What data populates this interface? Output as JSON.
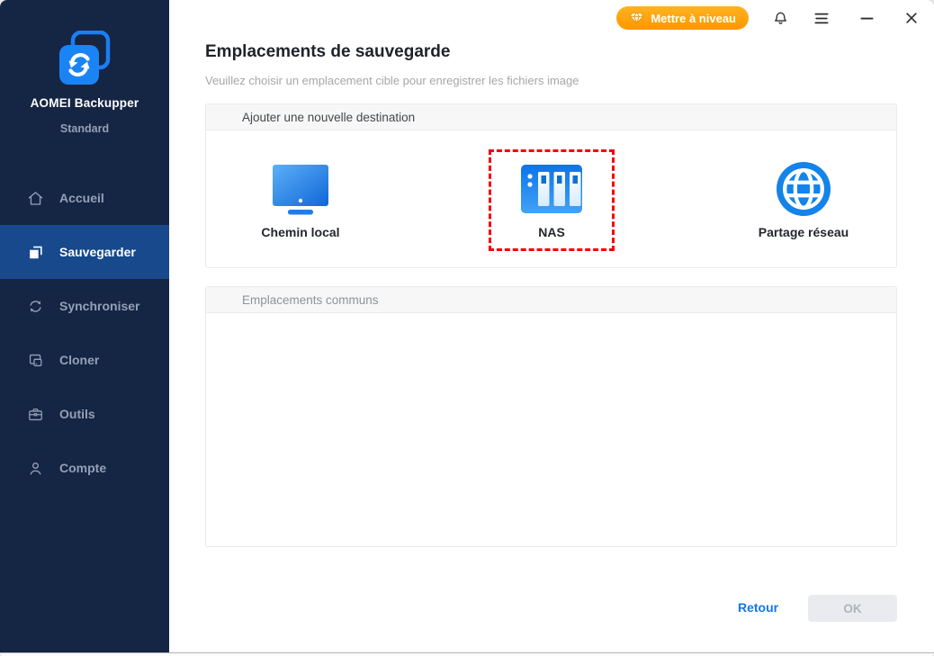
{
  "titlebar": {
    "upgrade_label": "Mettre à niveau"
  },
  "sidebar": {
    "app_name": "AOMEI Backupper",
    "edition": "Standard",
    "items": [
      {
        "label": "Accueil",
        "icon": "home-icon",
        "active": false
      },
      {
        "label": "Sauvegarder",
        "icon": "backup-icon",
        "active": true
      },
      {
        "label": "Synchroniser",
        "icon": "sync-icon",
        "active": false
      },
      {
        "label": "Cloner",
        "icon": "clone-icon",
        "active": false
      },
      {
        "label": "Outils",
        "icon": "tools-icon",
        "active": false
      },
      {
        "label": "Compte",
        "icon": "account-icon",
        "active": false
      }
    ]
  },
  "main": {
    "title": "Emplacements de sauvegarde",
    "subtitle": "Veuillez choisir un emplacement cible pour enregistrer les fichiers image",
    "add_destination_panel": {
      "header": "Ajouter une nouvelle destination",
      "options": [
        {
          "label": "Chemin local",
          "icon": "local-path-icon",
          "highlighted": false
        },
        {
          "label": "NAS",
          "icon": "nas-icon",
          "highlighted": true
        },
        {
          "label": "Partage réseau",
          "icon": "network-share-icon",
          "highlighted": false
        }
      ]
    },
    "common_locations_panel": {
      "header": "Emplacements communs",
      "items": []
    },
    "footer": {
      "back_label": "Retour",
      "ok_label": "OK",
      "ok_enabled": false
    }
  },
  "colors": {
    "sidebar_bg": "#152544",
    "active_item_bg": "#17498c",
    "accent_blue": "#1580e8",
    "upgrade_orange": "#ff9d00",
    "highlight_red": "#f40000"
  }
}
